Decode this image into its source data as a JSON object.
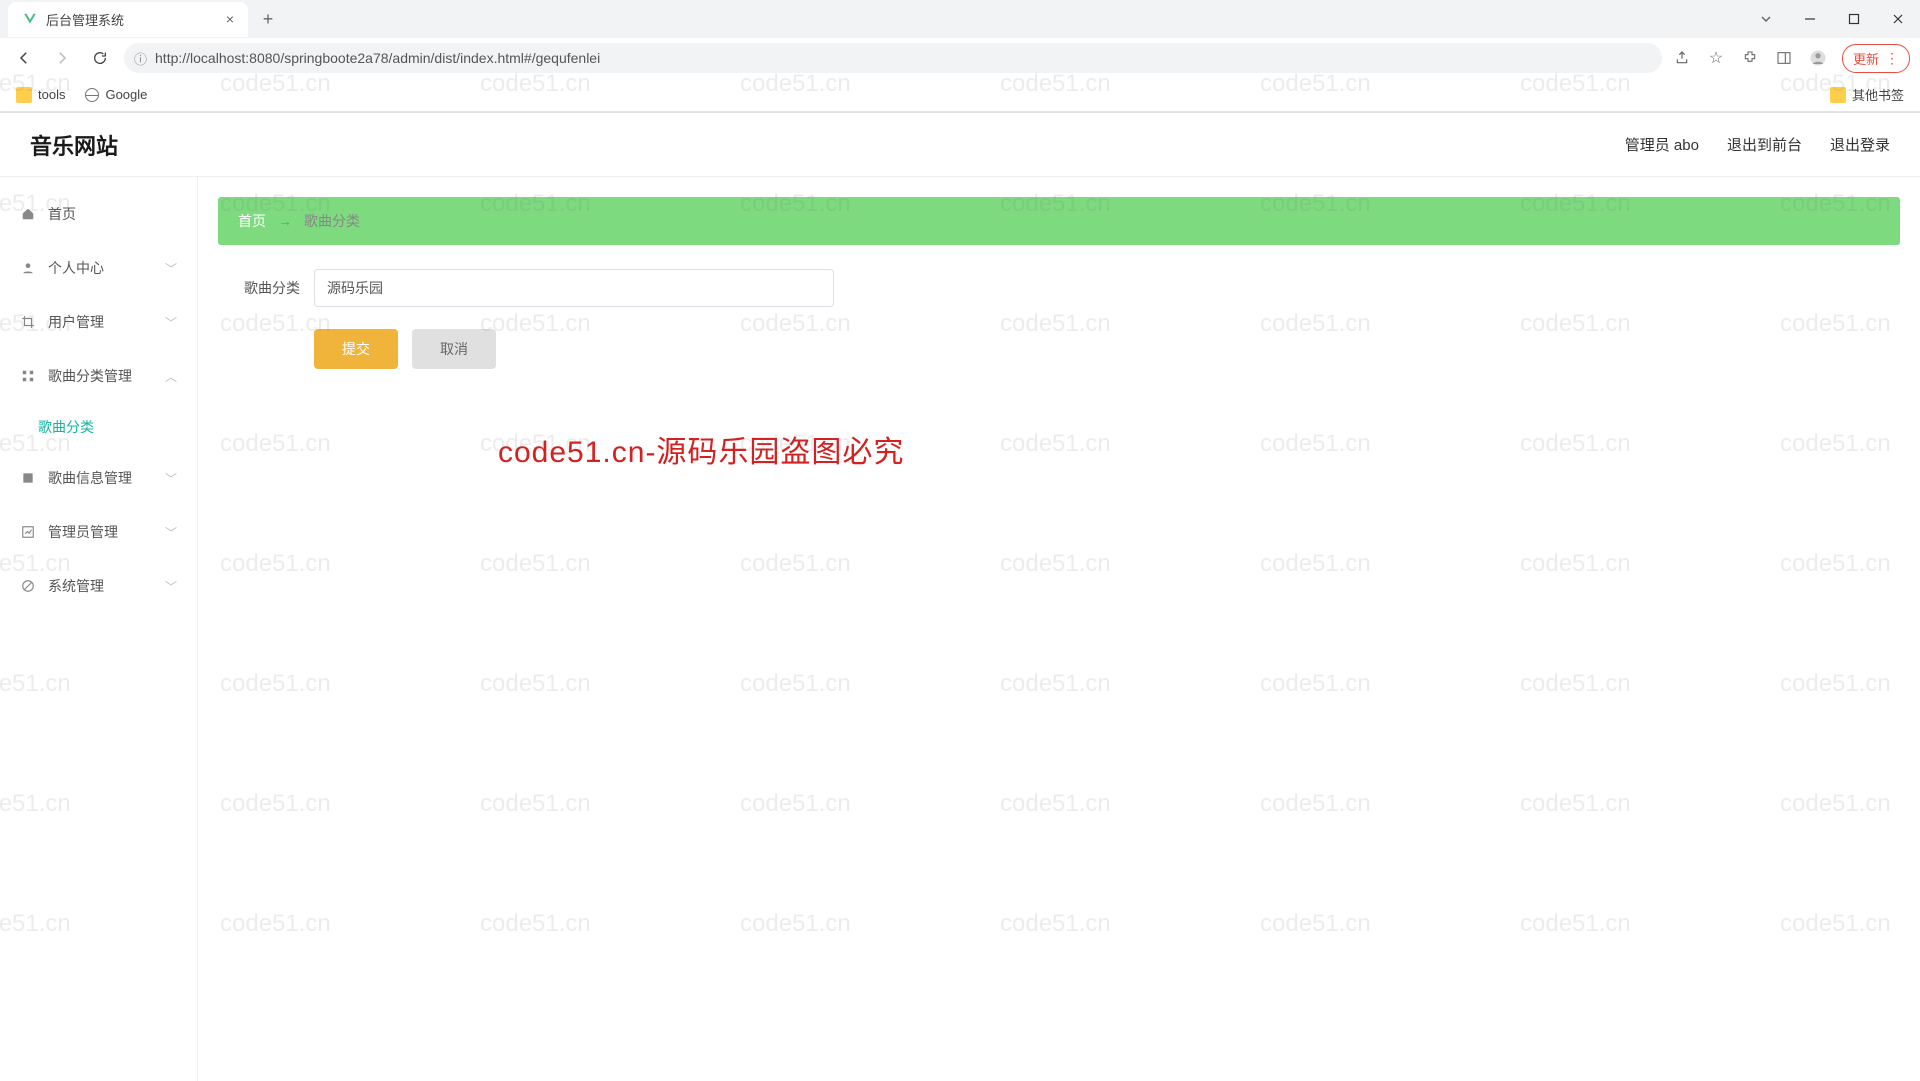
{
  "browser": {
    "tab_title": "后台管理系统",
    "url": "http://localhost:8080/springboote2a78/admin/dist/index.html#/gequfenlei",
    "update_label": "更新",
    "bookmarks": {
      "tools": "tools",
      "google": "Google",
      "other": "其他书签"
    }
  },
  "header": {
    "app_title": "音乐网站",
    "admin_label": "管理员 abo",
    "exit_front": "退出到前台",
    "logout": "退出登录"
  },
  "sidebar": {
    "home": "首页",
    "personal": "个人中心",
    "user_mgmt": "用户管理",
    "song_cat_mgmt": "歌曲分类管理",
    "song_cat": "歌曲分类",
    "song_info_mgmt": "歌曲信息管理",
    "admin_mgmt": "管理员管理",
    "sys_mgmt": "系统管理"
  },
  "breadcrumb": {
    "home": "首页",
    "arrow": "→",
    "current": "歌曲分类"
  },
  "form": {
    "label": "歌曲分类",
    "value": "源码乐园",
    "submit": "提交",
    "cancel": "取消"
  },
  "watermark_text": "code51.cn-源码乐园盗图必究",
  "wm_small": "code51.cn"
}
